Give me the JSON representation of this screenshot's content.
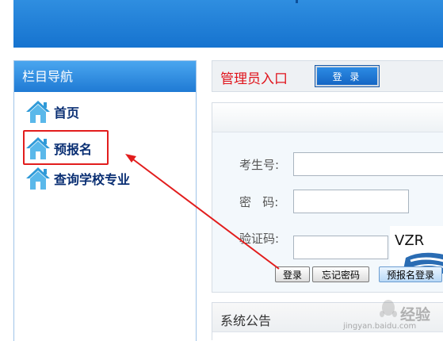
{
  "sidebar": {
    "title": "栏目导航",
    "items": [
      {
        "label": "首页"
      },
      {
        "label": "预报名"
      },
      {
        "label": "查询学校专业"
      }
    ]
  },
  "admin": {
    "title": "管理员入口",
    "login_button": "登 录"
  },
  "login_form": {
    "exam_id_label": "考生号:",
    "password_label": "密   码:",
    "captcha_label": "验证码:",
    "exam_id_value": "",
    "password_value": "",
    "captcha_value": "",
    "captcha_text": "VZR",
    "login_button": "登录",
    "forgot_button": "忘记密码",
    "prereg_login_button": "预报名登录"
  },
  "notice": {
    "title": "系统公告"
  },
  "watermark": {
    "brand": "经验",
    "url": "jingyan.baidu.com"
  },
  "colors": {
    "banner": "#1f7ad4",
    "highlight": "#e21d1d",
    "admin_title": "#e0141c",
    "nav_text": "#0a2f73"
  }
}
